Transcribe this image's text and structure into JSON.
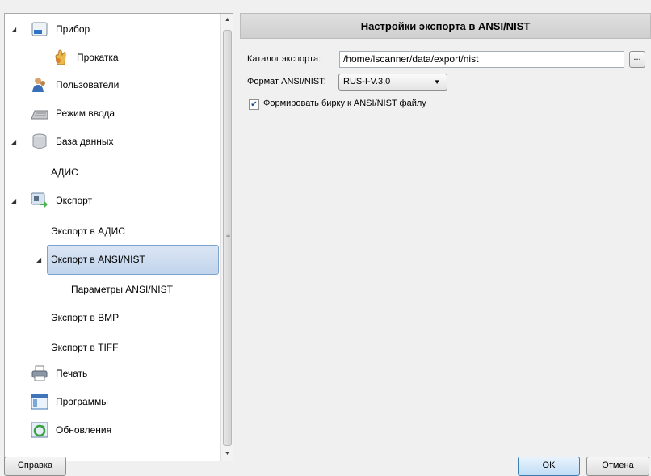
{
  "tree": {
    "items": [
      {
        "label": "Прибор",
        "icon": "device-icon"
      },
      {
        "label": "Прокатка",
        "icon": "fingerprint-hand-icon"
      },
      {
        "label": "Пользователи",
        "icon": "users-icon"
      },
      {
        "label": "Режим ввода",
        "icon": "keyboard-icon"
      },
      {
        "label": "База данных",
        "icon": "database-icon"
      },
      {
        "label": "АДИС",
        "icon": ""
      },
      {
        "label": "Экспорт",
        "icon": "export-icon"
      },
      {
        "label": "Экспорт в АДИС",
        "icon": ""
      },
      {
        "label": "Экспорт в ANSI/NIST",
        "icon": ""
      },
      {
        "label": "Параметры ANSI/NIST",
        "icon": ""
      },
      {
        "label": "Экспорт в BMP",
        "icon": ""
      },
      {
        "label": "Экспорт в TIFF",
        "icon": ""
      },
      {
        "label": "Печать",
        "icon": "printer-icon"
      },
      {
        "label": "Программы",
        "icon": "programs-window-icon"
      },
      {
        "label": "Обновления",
        "icon": "updates-icon"
      }
    ]
  },
  "panel": {
    "title": "Настройки экспорта в ANSI/NIST",
    "dir_label": "Каталог экспорта:",
    "dir_value": "/home/lscanner/data/export/nist",
    "browse_label": "...",
    "format_label": "Формат ANSI/NIST:",
    "format_value": "RUS-I-V.3.0",
    "checkbox_label": "Формировать бирку к ANSI/NIST файлу",
    "checkbox_checked": true
  },
  "footer": {
    "help": "Справка",
    "ok": "OK",
    "cancel": "Отмена"
  },
  "colors": {
    "selection": "#c1d4ec",
    "ok_border": "#3c7fb1"
  }
}
